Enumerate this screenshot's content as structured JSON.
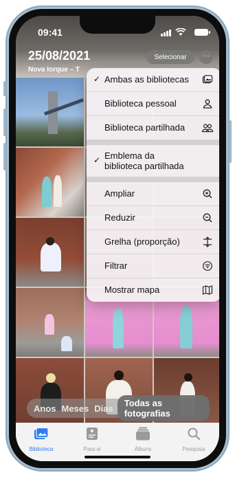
{
  "status": {
    "time": "09:41"
  },
  "header": {
    "date": "25/08/2021",
    "location": "Nova Iorque – T",
    "select_label": "Selecionar",
    "more_label": "···"
  },
  "menu": {
    "items": [
      {
        "label": "Ambas as bibliotecas",
        "checked": true,
        "icon": "photo-stack-icon"
      },
      {
        "label": "Biblioteca pessoal",
        "checked": false,
        "icon": "person-icon"
      },
      {
        "label": "Biblioteca partilhada",
        "checked": false,
        "icon": "people-icon"
      },
      {
        "label": "Emblema da biblioteca partilhada",
        "checked": true
      },
      {
        "label": "Ampliar",
        "checked": false,
        "icon": "zoom-in-icon"
      },
      {
        "label": "Reduzir",
        "checked": false,
        "icon": "zoom-out-icon"
      },
      {
        "label": "Grelha (proporção)",
        "checked": false,
        "icon": "aspect-icon"
      },
      {
        "label": "Filtrar",
        "checked": false,
        "icon": "filter-icon"
      },
      {
        "label": "Mostrar mapa",
        "checked": false,
        "icon": "map-icon"
      }
    ],
    "check": "✓"
  },
  "segments": {
    "years": "Anos",
    "months": "Meses",
    "days": "Dias",
    "all": "Todas as fotografias"
  },
  "tabs": {
    "library": "Biblioteca",
    "for_you": "Para si",
    "albums": "Álbuns",
    "search": "Pesquisa"
  },
  "colors": {
    "accent": "#2f7bf2",
    "menu_bg": "#f6f2f5"
  }
}
